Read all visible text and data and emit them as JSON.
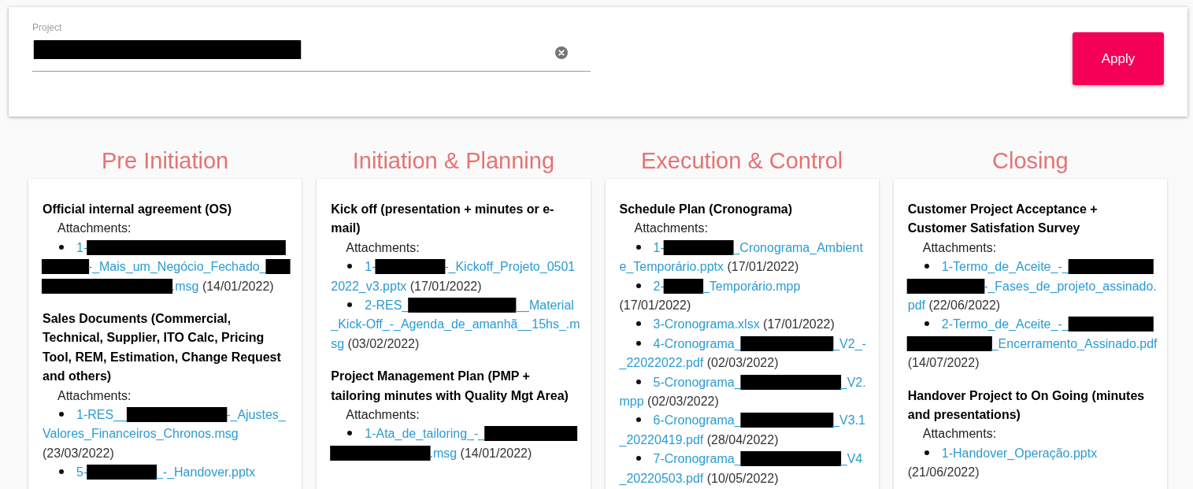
{
  "filter": {
    "field": {
      "label": "Project",
      "value": [
        {
          "kind": "redacted",
          "text": "████████████████████████████"
        }
      ]
    },
    "apply_button": "Apply"
  },
  "phases": [
    {
      "title": "Pre Initiation",
      "items": [
        {
          "title": "Official internal agreement (OS)",
          "attachments_label": "Attachments:",
          "attachments": [
            {
              "name": [
                {
                  "kind": "text",
                  "text": "1-"
                },
                {
                  "kind": "redacted",
                  "text": "████████████████████████████████"
                },
                {
                  "kind": "text",
                  "text": "-_Mais_um_Negócio_Fechado_"
                },
                {
                  "kind": "redacted",
                  "text": "████████████████████"
                },
                {
                  "kind": "text",
                  "text": ".msg"
                }
              ],
              "date": "(14/01/2022)"
            }
          ]
        },
        {
          "title": "Sales Documents (Commercial, Technical, Supplier, ITO Calc, Pricing Tool, REM, Estimation, Change Request and others)",
          "attachments_label": "Attachments:",
          "attachments": [
            {
              "name": [
                {
                  "kind": "text",
                  "text": "1-RES__"
                },
                {
                  "kind": "redacted",
                  "text": "█████████████"
                },
                {
                  "kind": "text",
                  "text": "-_Ajustes_Valores_Financeiros_Chronos.msg"
                }
              ],
              "date": "(23/03/2022)"
            },
            {
              "name": [
                {
                  "kind": "text",
                  "text": "5-"
                },
                {
                  "kind": "redacted",
                  "text": "█████████"
                },
                {
                  "kind": "text",
                  "text": "_-_Handover.pptx"
                }
              ]
            }
          ]
        }
      ]
    },
    {
      "title": "Initiation & Planning",
      "items": [
        {
          "title": "Kick off (presentation + minutes or e-mail)",
          "attachments_label": "Attachments:",
          "attachments": [
            {
              "name": [
                {
                  "kind": "text",
                  "text": "1-"
                },
                {
                  "kind": "redacted",
                  "text": "█████████"
                },
                {
                  "kind": "text",
                  "text": "-_Kickoff_Projeto_05012022_v3.pptx"
                }
              ],
              "date": "(17/01/2022)"
            },
            {
              "name": [
                {
                  "kind": "text",
                  "text": "2-RES_"
                },
                {
                  "kind": "redacted",
                  "text": "██████████████"
                },
                {
                  "kind": "text",
                  "text": "__Material_Kick-Off_-_Agenda_de_amanhã__15hs_.msg"
                }
              ],
              "date": "(03/02/2022)"
            }
          ]
        },
        {
          "title": "Project Management Plan (PMP + tailoring minutes with Quality Mgt Area)",
          "attachments_label": "Attachments:",
          "attachments": [
            {
              "name": [
                {
                  "kind": "text",
                  "text": "1-Ata_de_tailoring_-_"
                },
                {
                  "kind": "redacted",
                  "text": "█████████████████████████"
                },
                {
                  "kind": "text",
                  "text": ".msg"
                }
              ],
              "date": "(14/01/2022)"
            }
          ]
        }
      ]
    },
    {
      "title": "Execution & Control",
      "items": [
        {
          "title": "Schedule Plan (Cronograma)",
          "attachments_label": "Attachments:",
          "attachments": [
            {
              "name": [
                {
                  "kind": "text",
                  "text": "1-"
                },
                {
                  "kind": "redacted",
                  "text": "█████████"
                },
                {
                  "kind": "text",
                  "text": "_Cronograma_Ambiente_Temporário.pptx"
                }
              ],
              "date": "(17/01/2022)"
            },
            {
              "name": [
                {
                  "kind": "text",
                  "text": "2-"
                },
                {
                  "kind": "redacted",
                  "text": "█████"
                },
                {
                  "kind": "text",
                  "text": "_Temporário.mpp"
                }
              ],
              "date": "(17/01/2022)"
            },
            {
              "name": [
                {
                  "kind": "text",
                  "text": "3-Cronograma.xlsx"
                }
              ],
              "date": "(17/01/2022)"
            },
            {
              "name": [
                {
                  "kind": "text",
                  "text": "4-Cronograma_"
                },
                {
                  "kind": "redacted",
                  "text": "████████████"
                },
                {
                  "kind": "text",
                  "text": "_V2_-_22022022.pdf"
                }
              ],
              "date": "(02/03/2022)"
            },
            {
              "name": [
                {
                  "kind": "text",
                  "text": "5-Cronograma_"
                },
                {
                  "kind": "redacted",
                  "text": "█████████████"
                },
                {
                  "kind": "text",
                  "text": "_V2.mpp"
                }
              ],
              "date": "(02/03/2022)"
            },
            {
              "name": [
                {
                  "kind": "text",
                  "text": "6-Cronograma_"
                },
                {
                  "kind": "redacted",
                  "text": "████████████"
                },
                {
                  "kind": "text",
                  "text": "_V3.1_20220419.pdf"
                }
              ],
              "date": "(28/04/2022)"
            },
            {
              "name": [
                {
                  "kind": "text",
                  "text": "7-Cronograma_"
                },
                {
                  "kind": "redacted",
                  "text": "█████████████"
                },
                {
                  "kind": "text",
                  "text": "_V4_20220503.pdf"
                }
              ],
              "date": "(10/05/2022)"
            }
          ]
        }
      ]
    },
    {
      "title": "Closing",
      "items": [
        {
          "title": "Customer Project Acceptance + Customer Satisfation Survey",
          "attachments_label": "Attachments:",
          "attachments": [
            {
              "name": [
                {
                  "kind": "text",
                  "text": "1-Termo_de_Aceite_-_"
                },
                {
                  "kind": "redacted",
                  "text": "█████████████████████"
                },
                {
                  "kind": "text",
                  "text": "-_Fases_de_projeto_assinado.pdf"
                }
              ],
              "date": "(22/06/2022)"
            },
            {
              "name": [
                {
                  "kind": "text",
                  "text": "2-Termo_de_Aceite_-_"
                },
                {
                  "kind": "redacted",
                  "text": "██████████████████████"
                },
                {
                  "kind": "text",
                  "text": "_Encerramento_Assinado.pdf"
                }
              ],
              "date": "(14/07/2022)"
            }
          ]
        },
        {
          "title": "Handover Project to On Going (minutes and presentations)",
          "attachments_label": "Attachments:",
          "attachments": [
            {
              "name": [
                {
                  "kind": "text",
                  "text": "1-Handover_Operação.pptx"
                }
              ],
              "date": "(21/06/2022)"
            }
          ]
        }
      ]
    }
  ]
}
